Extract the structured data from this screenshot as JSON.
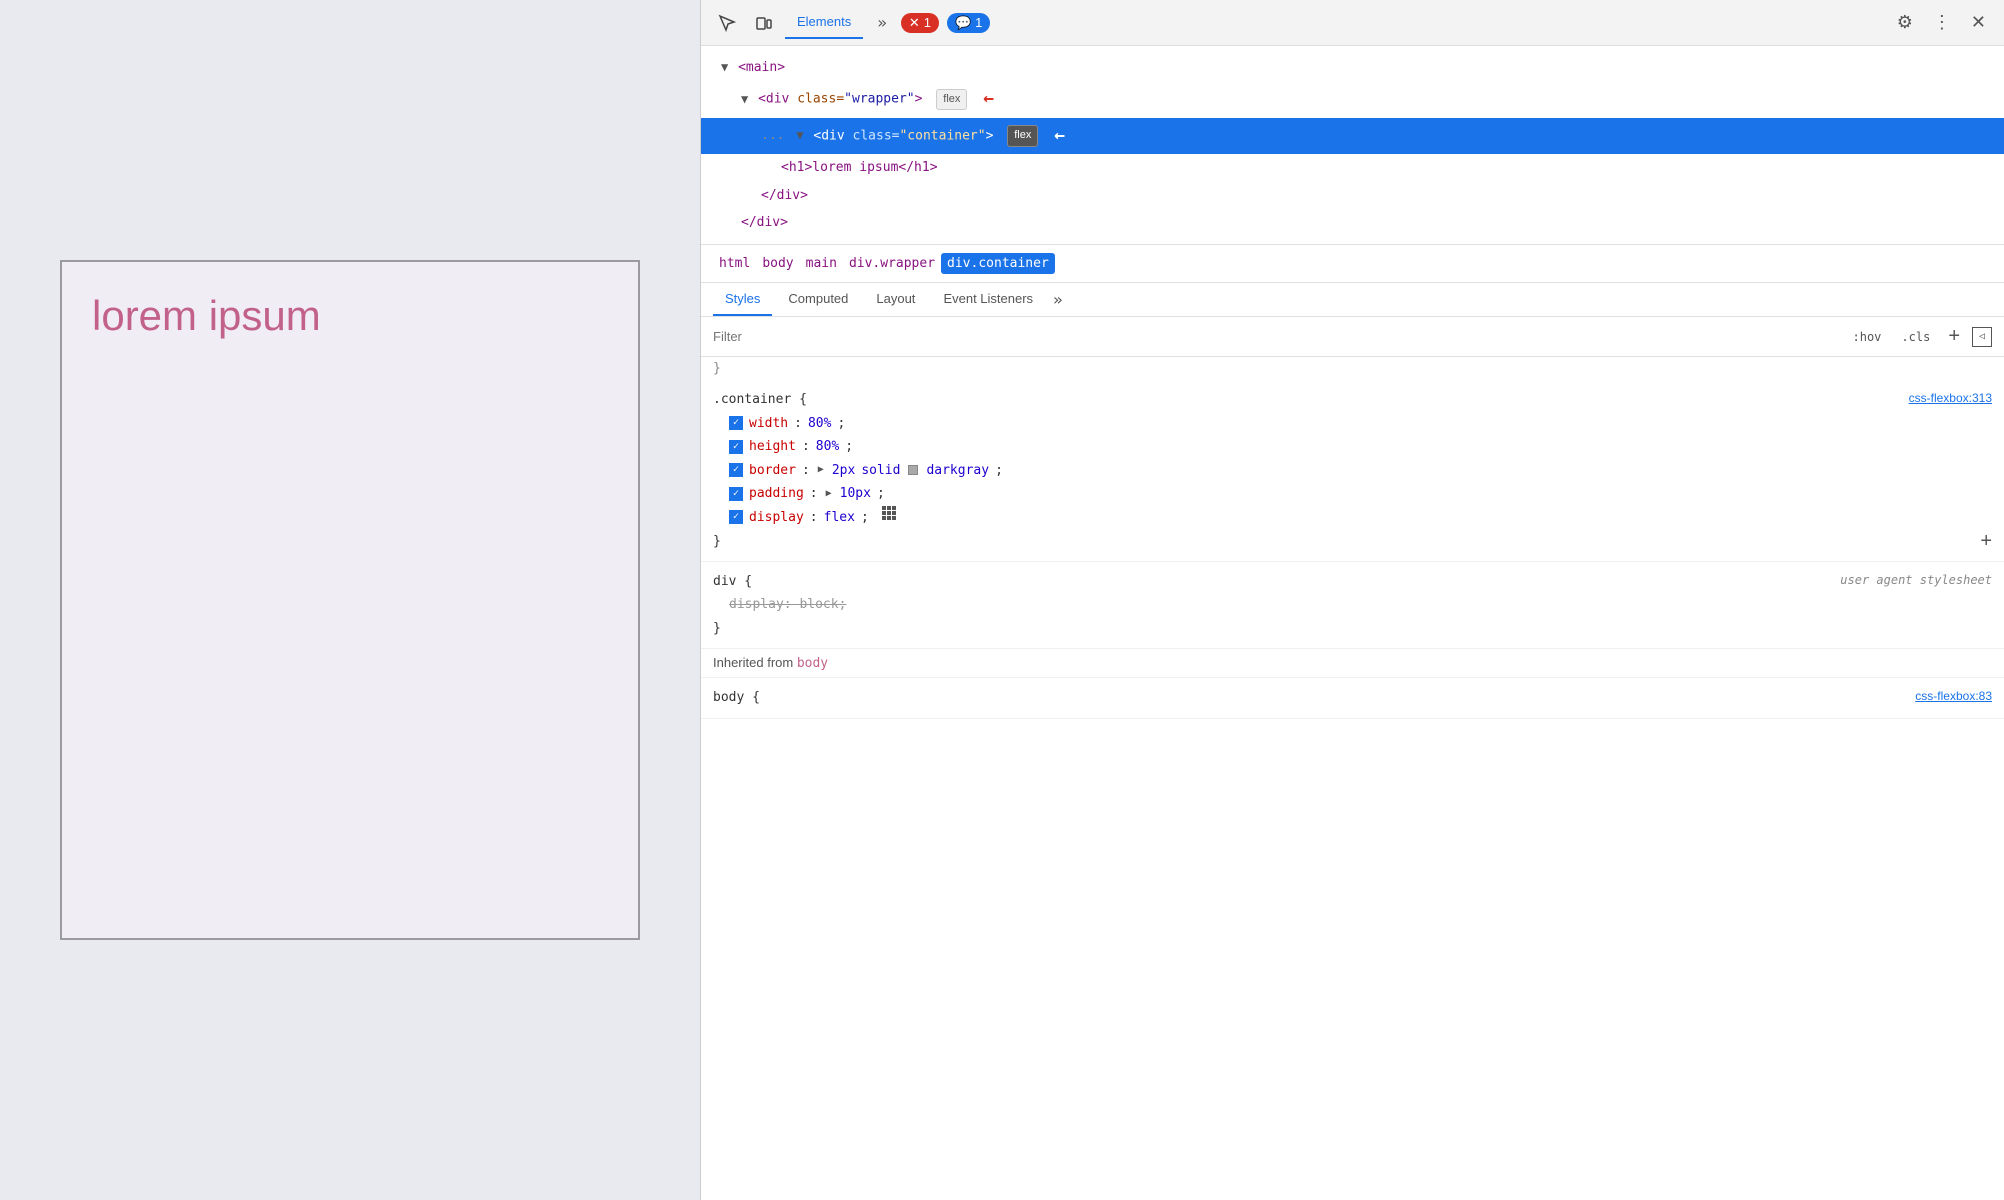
{
  "webpage": {
    "lorem_text": "lorem ipsum"
  },
  "devtools": {
    "toolbar": {
      "inspect_icon": "⬚",
      "device_icon": "▭",
      "elements_tab": "Elements",
      "more_tabs_icon": "»",
      "error_badge": "1",
      "info_badge": "1",
      "gear_icon": "⚙",
      "dots_icon": "⋮",
      "close_icon": "✕"
    },
    "html_tree": {
      "main_tag": "<main>",
      "wrapper_tag": "<div class=\"wrapper\">",
      "container_tag": "<div class=\"container\">",
      "h1_tag": "<h1>lorem ipsum</h1>",
      "div_close": "</div>",
      "main_close": "</div>",
      "flex_badge": "flex",
      "dots_prefix": "..."
    },
    "breadcrumb": {
      "items": [
        "html",
        "body",
        "main",
        "div.wrapper",
        "div.container"
      ]
    },
    "styles_tabs": {
      "items": [
        "Styles",
        "Computed",
        "Layout",
        "Event Listeners"
      ],
      "more": "»",
      "active": "Styles"
    },
    "filter": {
      "placeholder": "Filter",
      "hov_btn": ":hov",
      "cls_btn": ".cls",
      "plus_btn": "+",
      "icon_btn": "◁"
    },
    "css_rules": {
      "container_rule": {
        "selector": ".container {",
        "source": "css-flexbox:313",
        "properties": [
          {
            "checked": true,
            "name": "width",
            "value": "80%",
            "type": "normal"
          },
          {
            "checked": true,
            "name": "height",
            "value": "80%",
            "type": "normal"
          },
          {
            "checked": true,
            "name": "border",
            "value": "2px solid",
            "extra": "darkgray",
            "type": "border"
          },
          {
            "checked": true,
            "name": "padding",
            "value": "10px",
            "type": "expandable"
          },
          {
            "checked": true,
            "name": "display",
            "value": "flex",
            "type": "flex"
          }
        ],
        "close_brace": "}"
      },
      "div_rule": {
        "selector": "div {",
        "source": "user agent stylesheet",
        "properties": [
          {
            "checked": false,
            "name": "display",
            "value": "block",
            "type": "strikethrough"
          }
        ],
        "close_brace": "}"
      },
      "inherited_label": "Inherited from",
      "inherited_element": "body",
      "body_partial": "body {"
    }
  }
}
